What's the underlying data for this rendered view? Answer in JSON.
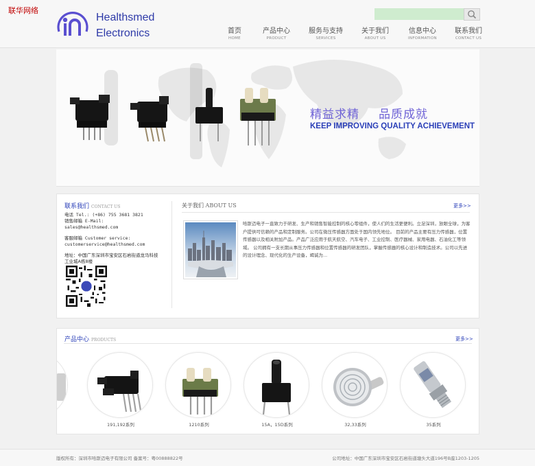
{
  "corner_tag": "联华网络",
  "brand": {
    "line1": "Healthsmed",
    "line2": "Electronics",
    "color": "#2e3aa8"
  },
  "search": {
    "value": "",
    "icon": "magnifier-icon"
  },
  "nav": [
    {
      "cn": "首页",
      "en": "HOME"
    },
    {
      "cn": "产品中心",
      "en": "PRODUCT"
    },
    {
      "cn": "服务与支持",
      "en": "SERVICES"
    },
    {
      "cn": "关于我们",
      "en": "ABOUT US"
    },
    {
      "cn": "信息中心",
      "en": "INFORMATION"
    },
    {
      "cn": "联系我们",
      "en": "CONTACT US"
    }
  ],
  "banner": {
    "slogan_cn_1": "精益求精",
    "slogan_cn_2": "品质成就",
    "slogan_en": "KEEP IMPROVING QUALITY ACHIEVEMENT"
  },
  "contact": {
    "title": "联系我们",
    "title_en": "CONTACT US",
    "tel": "电话 Tel.: (+86) 755 3681 3821",
    "sales_label": "销售邮箱 E-Mail:",
    "sales_email": "sales@healthsmed.com",
    "service_label": "客服邮箱 Customer service:",
    "service_email": "customerservice@healthsmed.com",
    "address": "地址：中国广东深圳市宝安区石岩街道龙马科技工业城A栋8楼"
  },
  "about": {
    "title": "关于我们",
    "title_en": "ABOUT US",
    "more": "更多>>",
    "text": "哈斯迈电子一直致力于研发、生产和销售智能控制的核心零组件，使人们的生活更便利。立足深圳，放眼全球，为客户提供可信赖的产品和定制服务。公司在微压传感器方面处于国内领先地位。 目前的产品主要有压力传感器，位置传感器以及相关附加产品。产品广泛应用于航天航空、汽车电子、工业控制、医疗器械、家用电器、石油化工等领域。 公司拥有一支长期从事压力传感器和位置传感器的研发团队，掌握传感器的核心设计和制造技术。公司以先进的设计理念、现代化的生产设备，竭诚为..."
  },
  "products": {
    "title": "产品中心",
    "title_en": "PRODUCTS",
    "more": "更多>>",
    "items": [
      {
        "caption": "191,192系列"
      },
      {
        "caption": "1210系列"
      },
      {
        "caption": "15A，15D系列"
      },
      {
        "caption": "32,33系列"
      },
      {
        "caption": "35系列"
      }
    ]
  },
  "footer": {
    "left": "版权所有：深圳市哈斯迈电子有限公司  备案号：粤00888822号",
    "right": "公司地址：中国广东深圳市宝安区石岩街道塘头大道196号B座1203-1205"
  }
}
